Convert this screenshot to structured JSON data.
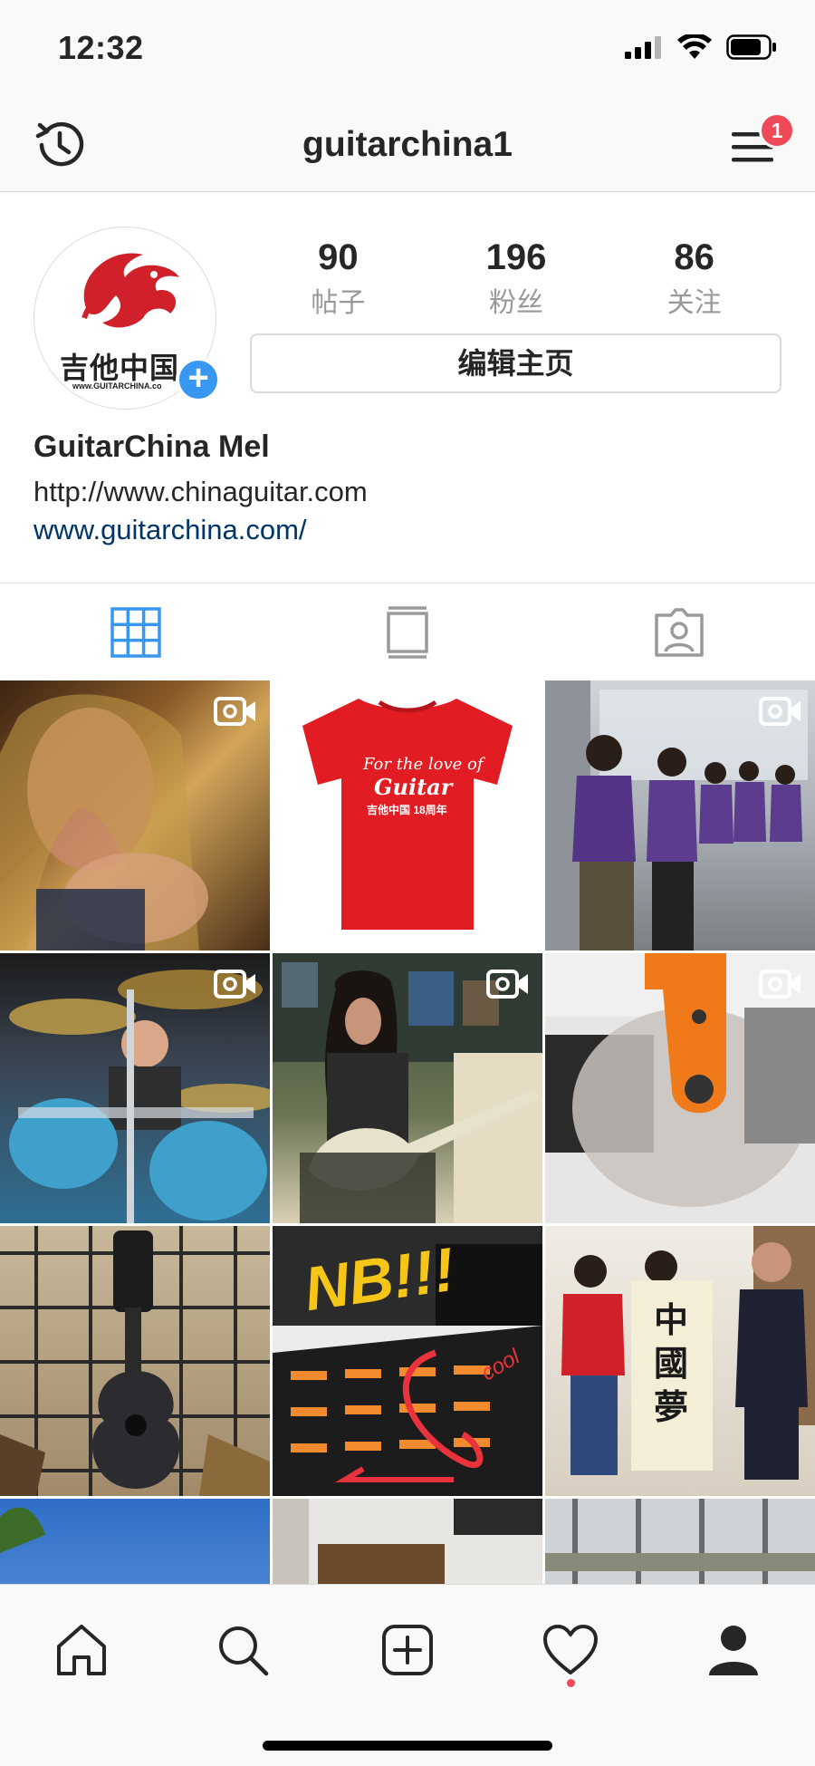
{
  "status_bar": {
    "time": "12:32"
  },
  "header": {
    "username": "guitarchina1",
    "menu_badge": "1"
  },
  "profile": {
    "avatar_logo_text": "吉他中国",
    "avatar_logo_subtext": "www.GUITARCHINA.co",
    "stats": [
      {
        "count": "90",
        "label": "帖子"
      },
      {
        "count": "196",
        "label": "粉丝"
      },
      {
        "count": "86",
        "label": "关注"
      }
    ],
    "edit_label": "编辑主页",
    "display_name": "GuitarChina Mel",
    "bio_line": "http://www.chinaguitar.com",
    "website": "www.guitarchina.com/"
  },
  "tabs": [
    {
      "name": "grid",
      "active": true
    },
    {
      "name": "feed",
      "active": false
    },
    {
      "name": "tagged",
      "active": false
    }
  ],
  "posts": [
    {
      "subject": "guitarist portrait",
      "video": true,
      "colors": [
        "#5a3a1c",
        "#c99a4a"
      ]
    },
    {
      "subject": "red t-shirt",
      "video": false,
      "colors": [
        "#ffffff",
        "#e11c23"
      ],
      "shirt_line1": "For the love of",
      "shirt_line2": "Guitar",
      "shirt_badge": "吉他中国 18周年"
    },
    {
      "subject": "group walking in purple shirts",
      "video": true,
      "colors": [
        "#9aa0a6",
        "#5b3b8c"
      ]
    },
    {
      "subject": "drum kit",
      "video": true,
      "colors": [
        "#3a4a5c",
        "#5ab4d6"
      ]
    },
    {
      "subject": "guitarist with white guitar",
      "video": true,
      "colors": [
        "#5e6e4a",
        "#d8cdb2"
      ]
    },
    {
      "subject": "orange machine",
      "video": true,
      "colors": [
        "#e0e0e0",
        "#f07a1a"
      ]
    },
    {
      "subject": "acoustic guitar on rack",
      "video": false,
      "colors": [
        "#b09a7a",
        "#2a2a2a"
      ]
    },
    {
      "subject": "books table",
      "video": false,
      "colors": [
        "#2a2a2a",
        "#f28a2e"
      ],
      "overlay_text": "NB!!!",
      "overlay_text2": "cool"
    },
    {
      "subject": "calligraphy scroll",
      "video": false,
      "colors": [
        "#e8e0d0",
        "#d0202a"
      ],
      "scroll_text": "中國夢"
    },
    {
      "subject": "sky",
      "video": false,
      "colors": [
        "#3a7ad0",
        "#9cc4f0"
      ]
    },
    {
      "subject": "interior room",
      "video": false,
      "colors": [
        "#e6e4e0",
        "#7a5a3a"
      ]
    },
    {
      "subject": "window view",
      "video": false,
      "colors": [
        "#cfd3d6",
        "#8a8a8a"
      ]
    }
  ],
  "bottom_nav": [
    {
      "name": "home"
    },
    {
      "name": "search"
    },
    {
      "name": "new-post"
    },
    {
      "name": "activity"
    },
    {
      "name": "profile"
    }
  ],
  "colors": {
    "accent": "#3897f0",
    "badge": "#ed4956",
    "link": "#003569"
  }
}
